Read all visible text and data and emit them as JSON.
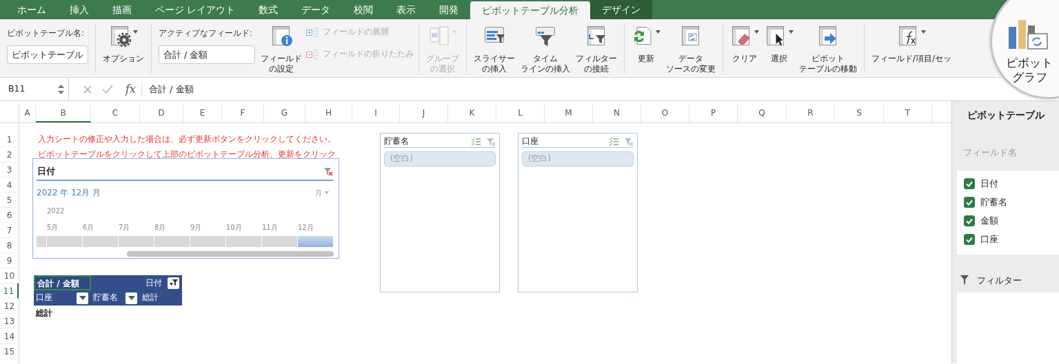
{
  "tabs": [
    {
      "label": "ホーム",
      "selected": false,
      "contextual": false
    },
    {
      "label": "挿入",
      "selected": false,
      "contextual": false
    },
    {
      "label": "描画",
      "selected": false,
      "contextual": false
    },
    {
      "label": "ページ レイアウト",
      "selected": false,
      "contextual": false
    },
    {
      "label": "数式",
      "selected": false,
      "contextual": false
    },
    {
      "label": "データ",
      "selected": false,
      "contextual": false
    },
    {
      "label": "校閲",
      "selected": false,
      "contextual": false
    },
    {
      "label": "表示",
      "selected": false,
      "contextual": false
    },
    {
      "label": "開発",
      "selected": false,
      "contextual": false
    },
    {
      "label": "ピボットテーブル分析",
      "selected": true,
      "contextual": true
    },
    {
      "label": "デザイン",
      "selected": false,
      "contextual": true
    }
  ],
  "ribbon": {
    "groups": [
      {
        "items": [
          {
            "kind": "field",
            "label": "ピボットテーブル名:",
            "value": "ピボットテーブル"
          }
        ]
      },
      {
        "items": [
          {
            "kind": "large",
            "label": [
              "オプション"
            ],
            "caret": true,
            "disabled": false
          }
        ]
      },
      {
        "items": [
          {
            "kind": "field",
            "label": "アクティブなフィールド:",
            "value": "合計 / 金額"
          },
          {
            "kind": "large",
            "label": [
              "フィールド",
              "の設定"
            ],
            "caret": false,
            "disabled": false
          },
          {
            "kind": "stack",
            "buttons": [
              {
                "label": "フィールドの展開",
                "disabled": true
              },
              {
                "label": "フィールドの折りたたみ",
                "disabled": true
              }
            ]
          }
        ]
      },
      {
        "items": [
          {
            "kind": "large",
            "label": [
              "グループ",
              "の選択"
            ],
            "caret": true,
            "disabled": true
          }
        ]
      },
      {
        "items": [
          {
            "kind": "large",
            "label": [
              "スライサー",
              "の挿入"
            ],
            "caret": false,
            "disabled": false
          },
          {
            "kind": "large",
            "label": [
              "タイム",
              "ラインの挿入"
            ],
            "caret": false,
            "disabled": false
          },
          {
            "kind": "large",
            "label": [
              "フィルター",
              "の接続"
            ],
            "caret": false,
            "disabled": false
          }
        ]
      },
      {
        "items": [
          {
            "kind": "large",
            "label": [
              "更新"
            ],
            "caret": true,
            "disabled": false
          },
          {
            "kind": "large",
            "label": [
              "データ",
              "ソースの変更"
            ],
            "caret": false,
            "disabled": false
          }
        ]
      },
      {
        "items": [
          {
            "kind": "large",
            "label": [
              "クリア"
            ],
            "caret": true,
            "disabled": false
          },
          {
            "kind": "large",
            "label": [
              "選択"
            ],
            "caret": true,
            "disabled": false
          },
          {
            "kind": "large",
            "label": [
              "ピボット",
              "テーブルの移動"
            ],
            "caret": false,
            "disabled": false
          }
        ]
      },
      {
        "items": [
          {
            "kind": "large",
            "label": [
              "フィールド/項目/セッ"
            ],
            "caret": true,
            "disabled": false
          }
        ]
      }
    ]
  },
  "magnifier": {
    "label": [
      "ピボット",
      "グラフ"
    ]
  },
  "formula_bar": {
    "name_box": "B11",
    "function_label": "fx",
    "formula": "合計 / 金額"
  },
  "columns": [
    {
      "label": "A",
      "selected": false
    },
    {
      "label": "B",
      "selected": true
    },
    {
      "label": "C",
      "selected": false
    },
    {
      "label": "D",
      "selected": false
    },
    {
      "label": "E",
      "selected": false
    },
    {
      "label": "F",
      "selected": false
    },
    {
      "label": "G",
      "selected": false
    },
    {
      "label": "H",
      "selected": false
    },
    {
      "label": "I",
      "selected": false
    },
    {
      "label": "J",
      "selected": false
    },
    {
      "label": "K",
      "selected": false
    },
    {
      "label": "L",
      "selected": false
    },
    {
      "label": "M",
      "selected": false
    },
    {
      "label": "N",
      "selected": false
    },
    {
      "label": "O",
      "selected": false
    },
    {
      "label": "P",
      "selected": false
    },
    {
      "label": "Q",
      "selected": false
    },
    {
      "label": "R",
      "selected": false
    },
    {
      "label": "S",
      "selected": false
    },
    {
      "label": "T",
      "selected": false
    }
  ],
  "rows": [
    {
      "label": "1",
      "selected": false
    },
    {
      "label": "2",
      "selected": false
    },
    {
      "label": "3",
      "selected": false
    },
    {
      "label": "4",
      "selected": false
    },
    {
      "label": "5",
      "selected": false
    },
    {
      "label": "6",
      "selected": false
    },
    {
      "label": "7",
      "selected": false
    },
    {
      "label": "8",
      "selected": false
    },
    {
      "label": "9",
      "selected": false
    },
    {
      "label": "10",
      "selected": false
    },
    {
      "label": "11",
      "selected": true
    },
    {
      "label": "12",
      "selected": false
    },
    {
      "label": "13",
      "selected": false
    },
    {
      "label": "14",
      "selected": false
    },
    {
      "label": "15",
      "selected": false
    }
  ],
  "notes": [
    "入力シートの修正や入力した場合は、必ず更新ボタンをクリックしてください。",
    "ピボットテーブルをクリックして上部のピボットテーブル分析、更新をクリック"
  ],
  "timeline": {
    "title": "日付",
    "period": "2022 年 12月 月",
    "level": "月",
    "year": "2022",
    "months": [
      {
        "label": "5月",
        "selected": false
      },
      {
        "label": "6月",
        "selected": false
      },
      {
        "label": "7月",
        "selected": false
      },
      {
        "label": "8月",
        "selected": false
      },
      {
        "label": "9月",
        "selected": false
      },
      {
        "label": "10月",
        "selected": false
      },
      {
        "label": "11月",
        "selected": false
      },
      {
        "label": "12月",
        "selected": true
      }
    ]
  },
  "slicers": [
    {
      "title": "貯蓄名",
      "items": [
        {
          "label": "(空白)",
          "selected": true
        }
      ]
    },
    {
      "title": "口座",
      "items": [
        {
          "label": "(空白)",
          "selected": true
        }
      ]
    }
  ],
  "pivot_table": {
    "header": "合計 / 金額",
    "column_field": "日付",
    "row_fields": [
      "口座",
      "貯蓄名"
    ],
    "grand_total_column": "総計",
    "grand_total_row": "総計"
  },
  "field_list": {
    "title": "ピボットテーブル",
    "section_label": "フィールド名",
    "fields": [
      {
        "label": "日付",
        "checked": true
      },
      {
        "label": "貯蓄名",
        "checked": true
      },
      {
        "label": "金額",
        "checked": true
      },
      {
        "label": "口座",
        "checked": true
      }
    ],
    "filter_label": "フィルター"
  }
}
